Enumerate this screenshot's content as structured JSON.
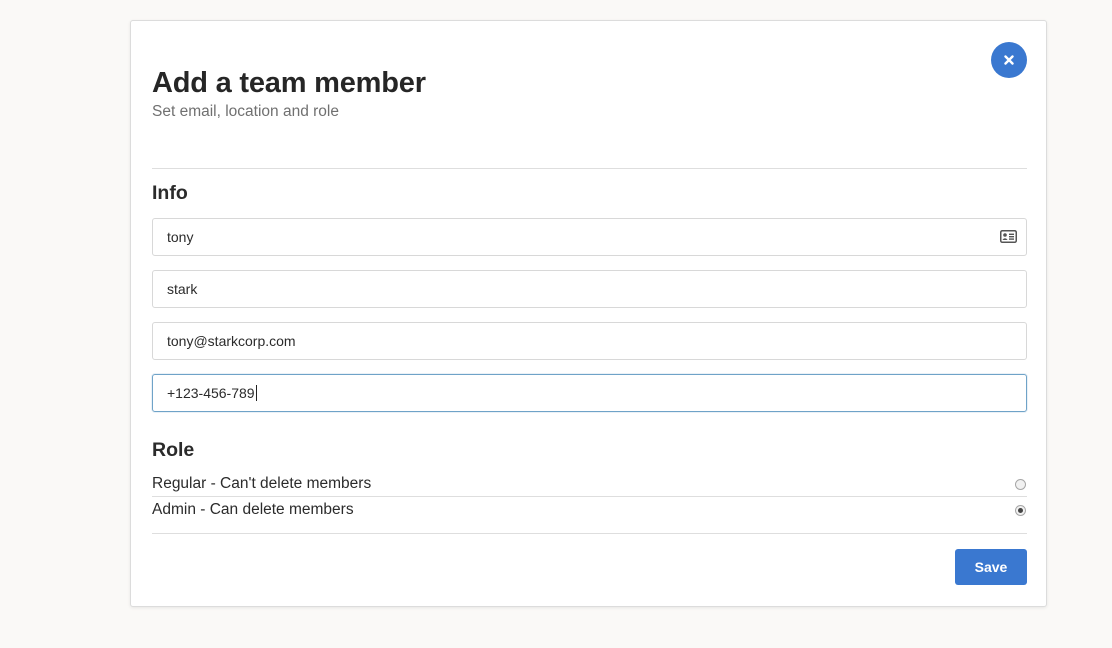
{
  "modal": {
    "title": "Add a team member",
    "subtitle": "Set email, location and role",
    "close_icon": "close-icon"
  },
  "info": {
    "heading": "Info",
    "fields": [
      {
        "value": "tony",
        "icon": "id-card-icon"
      },
      {
        "value": "stark"
      },
      {
        "value": "tony@starkcorp.com"
      },
      {
        "value": "+123-456-789",
        "focused": true
      }
    ]
  },
  "role": {
    "heading": "Role",
    "options": [
      {
        "label": "Regular - Can't delete members",
        "selected": false
      },
      {
        "label": "Admin - Can delete members",
        "selected": true
      }
    ]
  },
  "actions": {
    "save_label": "Save"
  },
  "colors": {
    "accent": "#3a78d0",
    "focus_border": "#6fa3c8",
    "background": "#faf9f7"
  }
}
